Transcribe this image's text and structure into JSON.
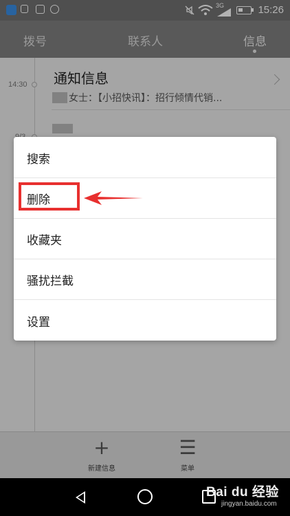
{
  "status_bar": {
    "time": "15:26",
    "network": "3G"
  },
  "tabs": [
    {
      "label": "拨号"
    },
    {
      "label": "联系人"
    },
    {
      "label": "信息"
    }
  ],
  "messages": [
    {
      "time": "14:30",
      "title": "通知信息",
      "preview_visible": "女士：【小招快讯】：招行倾情代销..."
    },
    {
      "time": "9/3"
    }
  ],
  "menu": {
    "items": [
      {
        "label": "搜索"
      },
      {
        "label": "删除"
      },
      {
        "label": "收藏夹"
      },
      {
        "label": "骚扰拦截"
      },
      {
        "label": "设置"
      }
    ]
  },
  "action_bar": {
    "new_message": "新建信息",
    "menu": "菜单"
  },
  "watermark": {
    "brand": "Bai du 经验",
    "url": "jingyan.baidu.com"
  },
  "colors": {
    "highlight_box": "#e8302f",
    "arrow": "#e8302f"
  }
}
